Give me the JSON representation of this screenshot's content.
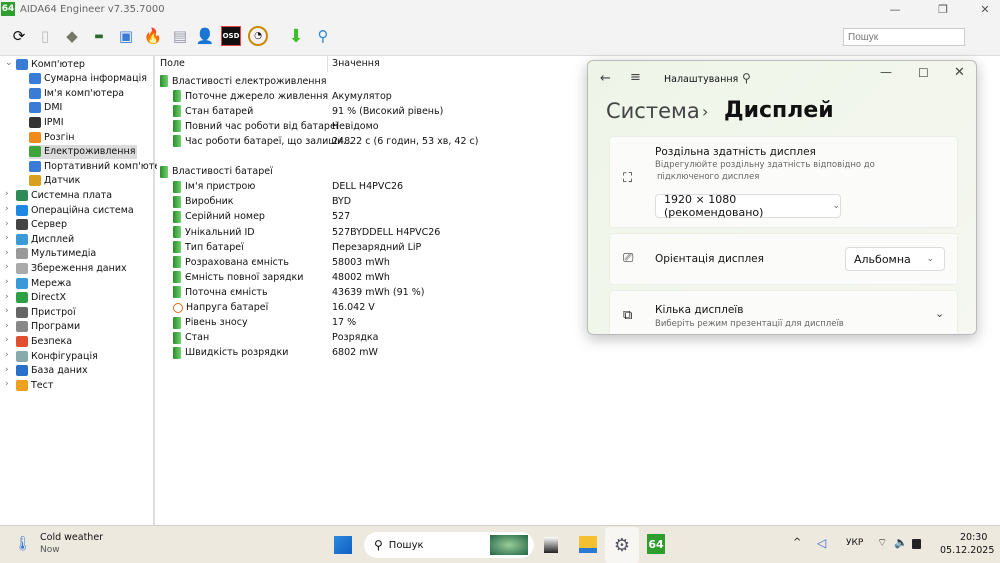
{
  "app": {
    "logo": "64",
    "title": "AIDA64 Engineer v7.35.7000",
    "search_placeholder": "Пошук"
  },
  "toolbar": {
    "icons": [
      "refresh-icon",
      "report-icon",
      "motherboard-icon",
      "memory-icon",
      "network-icon",
      "burn-icon",
      "config-icon",
      "user-icon",
      "osd-icon",
      "gauge-icon",
      "download-icon",
      "search-icon"
    ],
    "osd_label": "OSD"
  },
  "tree": [
    {
      "label": "Комп'ютер",
      "level": 0,
      "expanded": true,
      "icon": "computer-icon",
      "color": "#3a7bd5"
    },
    {
      "label": "Сумарна інформація",
      "level": 1,
      "icon": "computer-icon",
      "color": "#3a7bd5"
    },
    {
      "label": "Ім'я комп'ютера",
      "level": 1,
      "icon": "computer-icon",
      "color": "#3a7bd5"
    },
    {
      "label": "DMI",
      "level": 1,
      "icon": "computer-icon",
      "color": "#3a7bd5"
    },
    {
      "label": "IPMI",
      "level": 1,
      "icon": "server-icon",
      "color": "#333"
    },
    {
      "label": "Розгін",
      "level": 1,
      "icon": "flame-icon",
      "color": "#f08a1c"
    },
    {
      "label": "Електроживлення",
      "level": 1,
      "icon": "battery-icon",
      "color": "#3da33d",
      "selected": true
    },
    {
      "label": "Портативний комп'ютер",
      "level": 1,
      "icon": "laptop-icon",
      "color": "#3a7bd5"
    },
    {
      "label": "Датчик",
      "level": 1,
      "icon": "gauge-icon",
      "color": "#d9a020"
    },
    {
      "label": "Системна плата",
      "level": 0,
      "icon": "motherboard-icon",
      "color": "#2e8b57"
    },
    {
      "label": "Операційна система",
      "level": 0,
      "icon": "windows-icon",
      "color": "#1e88e5"
    },
    {
      "label": "Сервер",
      "level": 0,
      "icon": "server-icon",
      "color": "#444"
    },
    {
      "label": "Дисплей",
      "level": 0,
      "icon": "display-icon",
      "color": "#3a9ad9"
    },
    {
      "label": "Мультимедіа",
      "level": 0,
      "icon": "speaker-icon",
      "color": "#999"
    },
    {
      "label": "Збереження даних",
      "level": 0,
      "icon": "disk-icon",
      "color": "#aaa"
    },
    {
      "label": "Мережа",
      "level": 0,
      "icon": "network-icon",
      "color": "#3a9ad9"
    },
    {
      "label": "DirectX",
      "level": 0,
      "icon": "xbox-icon",
      "color": "#2ea043"
    },
    {
      "label": "Пристрої",
      "level": 0,
      "icon": "devices-icon",
      "color": "#666"
    },
    {
      "label": "Програми",
      "level": 0,
      "icon": "programs-icon",
      "color": "#888"
    },
    {
      "label": "Безпека",
      "level": 0,
      "icon": "shield-icon",
      "color": "#e05030"
    },
    {
      "label": "Конфігурація",
      "level": 0,
      "icon": "config-icon",
      "color": "#8aa"
    },
    {
      "label": "База даних",
      "level": 0,
      "icon": "database-icon",
      "color": "#2a6fc9"
    },
    {
      "label": "Тест",
      "level": 0,
      "icon": "test-icon",
      "color": "#f0a020"
    }
  ],
  "list": {
    "col_field": "Поле",
    "col_value": "Значення",
    "rows": [
      {
        "field": "Властивості електроживлення",
        "value": "",
        "group": true
      },
      {
        "field": "Поточне джерело живлення",
        "value": "Акумулятор"
      },
      {
        "field": "Стан батарей",
        "value": "91 % (Високий рівень)"
      },
      {
        "field": "Повний час роботи від батареї",
        "value": "Невідомо"
      },
      {
        "field": "Час роботи батареї, що залиши...",
        "value": "24822 с (6 годин, 53 хв, 42 с)"
      },
      {
        "field": "",
        "value": "",
        "spacer": true
      },
      {
        "field": "Властивості батареї",
        "value": "",
        "group": true
      },
      {
        "field": "Ім'я пристрою",
        "value": "DELL H4PVC26"
      },
      {
        "field": "Виробник",
        "value": "BYD"
      },
      {
        "field": "Серійний номер",
        "value": "527"
      },
      {
        "field": "Унікальний ID",
        "value": "527BYDDELL H4PVC26"
      },
      {
        "field": "Тип батареї",
        "value": "Перезарядний LiP"
      },
      {
        "field": "Розрахована ємність",
        "value": "58003 mWh"
      },
      {
        "field": "Ємність повної зарядки",
        "value": "48002 mWh"
      },
      {
        "field": "Поточна ємність",
        "value": "43639 mWh  (91 %)"
      },
      {
        "field": "Напруга батареї",
        "value": "16.042 V",
        "icon": "voltage-icon"
      },
      {
        "field": "Рівень зносу",
        "value": "17 %"
      },
      {
        "field": "Стан",
        "value": "Розрядка"
      },
      {
        "field": "Швидкість розрядки",
        "value": "6802 mW"
      }
    ]
  },
  "settings": {
    "app_name": "Налаштування",
    "crumb_parent": "Система",
    "crumb_sep": "›",
    "crumb_current": "Дисплей",
    "resolution": {
      "title": "Роздільна здатність дисплея",
      "desc1": "Відрегулюйте роздільну здатність відповідно до",
      "desc2": "підключеного дисплея",
      "value": "1920 × 1080 (рекомендовано)"
    },
    "orientation": {
      "title": "Орієнтація дисплея",
      "value": "Альбомна"
    },
    "multi": {
      "title": "Кілька дисплеїв",
      "desc": "Виберіть режим презентації для дисплеїв"
    }
  },
  "taskbar": {
    "weather_title": "Cold weather",
    "weather_sub": "Now",
    "search": "Пошук",
    "app64": "64",
    "lang": "УКР",
    "time": "20:30",
    "date": "05.12.2025"
  }
}
